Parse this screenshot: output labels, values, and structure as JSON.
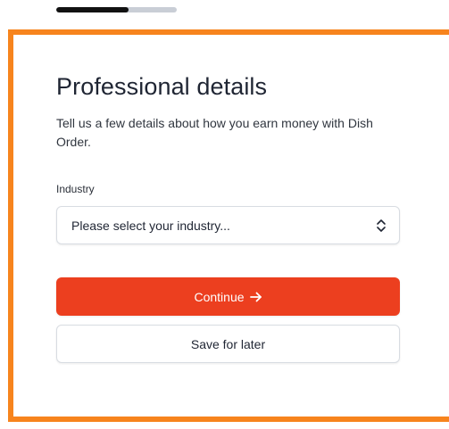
{
  "progress": {
    "fraction_complete": 0.6,
    "fill_color": "#111111",
    "track_color": "#c9ced6"
  },
  "highlight": {
    "color": "#f7841d"
  },
  "form": {
    "title": "Professional details",
    "subtitle": "Tell us a few details about how you earn money with Dish Order.",
    "industry": {
      "label": "Industry",
      "selected_value": "Please select your industry...",
      "icon": "chevron-up-down-icon"
    },
    "continue_button": {
      "label": "Continue",
      "icon": "arrow-right-icon",
      "color": "#ec3f1f"
    },
    "save_button": {
      "label": "Save for later"
    }
  }
}
